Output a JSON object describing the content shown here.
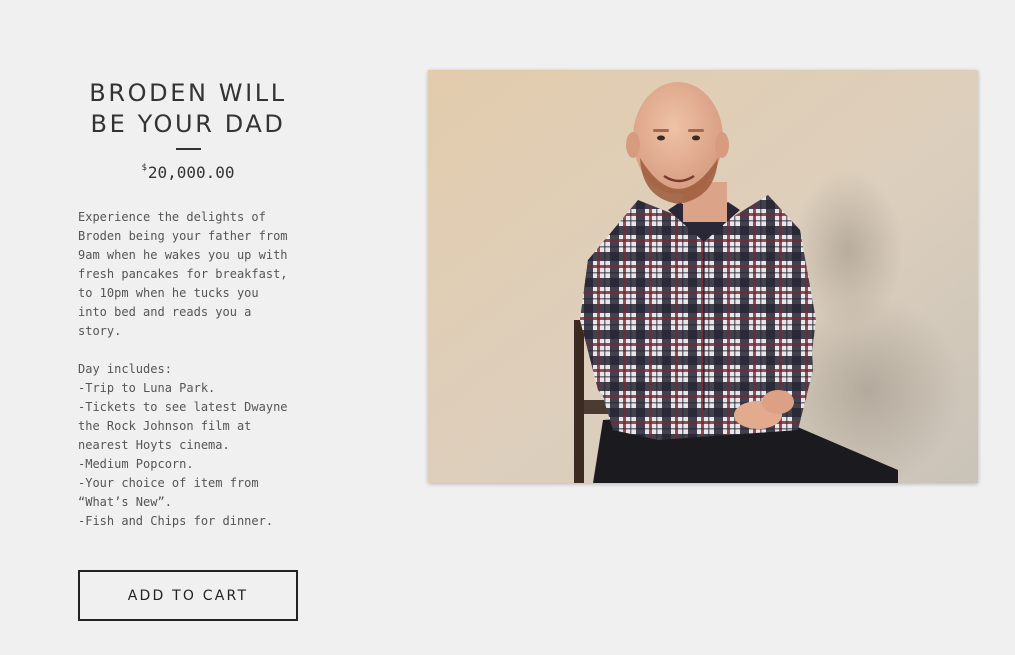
{
  "product": {
    "title_line1": "BRODEN WILL",
    "title_line2": "BE YOUR DAD",
    "price_currency": "$",
    "price_amount": "20,000.00",
    "description_lines": [
      "Experience the delights of",
      "Broden being your father from",
      "9am when he wakes you up with",
      "fresh pancakes for breakfast,",
      "to 10pm when he tucks you",
      "into bed and reads you a",
      "story."
    ],
    "includes_lines": [
      "Day includes:",
      "-Trip to Luna Park.",
      "-Tickets to see latest Dwayne",
      "the Rock Johnson film at",
      "nearest Hoyts cinema.",
      "-Medium Popcorn.",
      "-Your choice of item from",
      "“What’s New”.",
      "-Fish and Chips for dinner."
    ],
    "add_to_cart_label": "ADD TO CART"
  },
  "image": {
    "subject": "photo of a smiling bald bearded man in a plaid shirt seated on a chair against a beige wall"
  },
  "colors": {
    "background": "#f0f0f0",
    "text": "#333333",
    "button_border": "#222222"
  }
}
